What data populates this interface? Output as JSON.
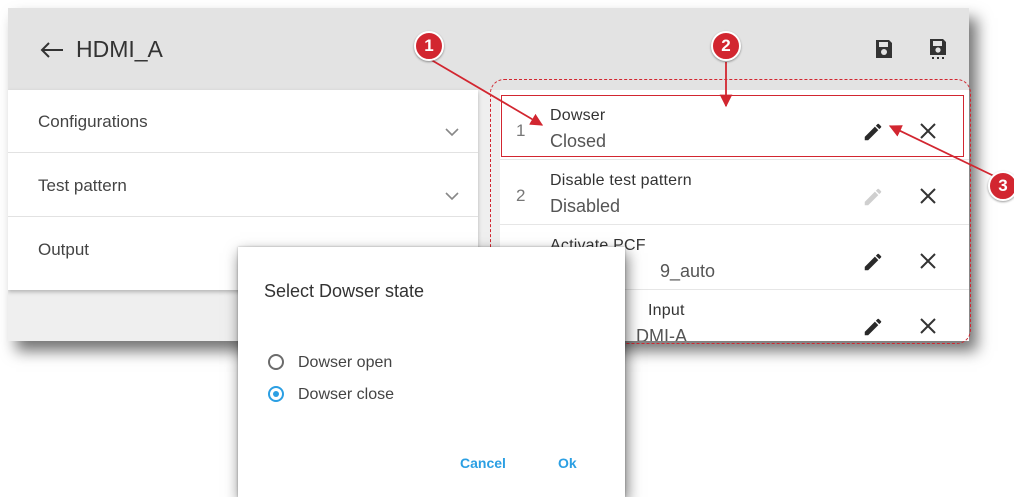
{
  "app": {
    "title": "HDMI_A",
    "back_icon": "back-arrow-icon",
    "save_icon": "save-icon",
    "save_as_icon": "save-as-icon"
  },
  "left_panel": {
    "items": [
      {
        "label": "Configurations",
        "icon": "chevron-down-icon"
      },
      {
        "label": "Test pattern",
        "icon": "chevron-down-icon"
      },
      {
        "label": "Output",
        "icon": "chevron-down-icon"
      }
    ]
  },
  "steps": [
    {
      "number": "1",
      "title": "Dowser",
      "value": "Closed",
      "edit_enabled": true
    },
    {
      "number": "2",
      "title": "Disable test pattern",
      "value": "Disabled",
      "edit_enabled": false
    },
    {
      "number": "",
      "title": "Activate PCF",
      "value": "9_auto",
      "edit_enabled": true
    },
    {
      "number": "",
      "title": "Input",
      "value": "DMI-A",
      "edit_enabled": true
    }
  ],
  "dialog": {
    "title": "Select Dowser state",
    "options": [
      {
        "label": "Dowser open",
        "selected": false
      },
      {
        "label": "Dowser close",
        "selected": true
      }
    ],
    "cancel_label": "Cancel",
    "ok_label": "Ok"
  },
  "callouts": {
    "c1": "1",
    "c2": "2",
    "c3": "3"
  },
  "colors": {
    "accent": "#2b9fe3",
    "callout": "#d22630",
    "appbar": "#e3e3e3"
  }
}
